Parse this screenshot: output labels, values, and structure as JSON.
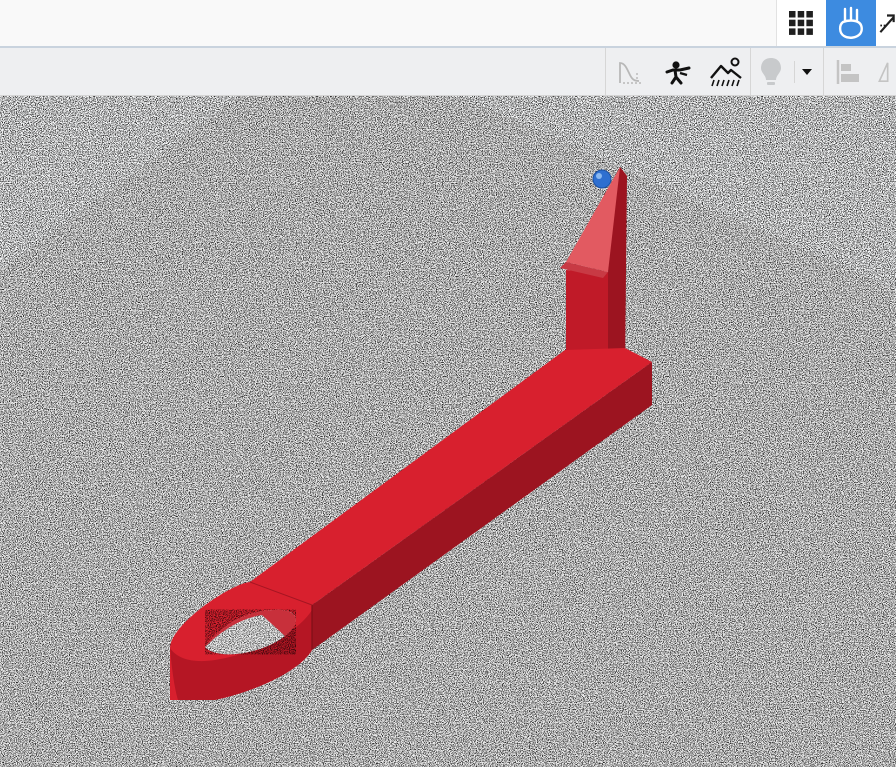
{
  "topbar": {
    "buttons": [
      {
        "icon": "grid-icon",
        "active": false
      },
      {
        "icon": "hand-pointer-icon",
        "active": true
      },
      {
        "icon": "tool-partial-icon",
        "active": false
      }
    ]
  },
  "toolbar": {
    "tools": [
      {
        "icon": "curve-sketch-icon",
        "disabled": true
      },
      {
        "icon": "person-viewpoint-icon",
        "disabled": false
      },
      {
        "icon": "lighting-scene-icon",
        "disabled": false
      },
      {
        "icon": "lightbulb-icon",
        "disabled": true
      },
      {
        "icon": "dropdown-caret-icon",
        "disabled": false
      },
      {
        "icon": "align-icon",
        "disabled": true
      },
      {
        "icon": "measure-triangle-icon",
        "disabled": true
      }
    ]
  },
  "viewport": {
    "model": "red-lever-part",
    "colors": {
      "accent": "#3d8be0",
      "part_top": "#d8202e",
      "part_side": "#9c1420",
      "part_front": "#bc1b28",
      "handle_point": "#2e6fd0"
    }
  }
}
